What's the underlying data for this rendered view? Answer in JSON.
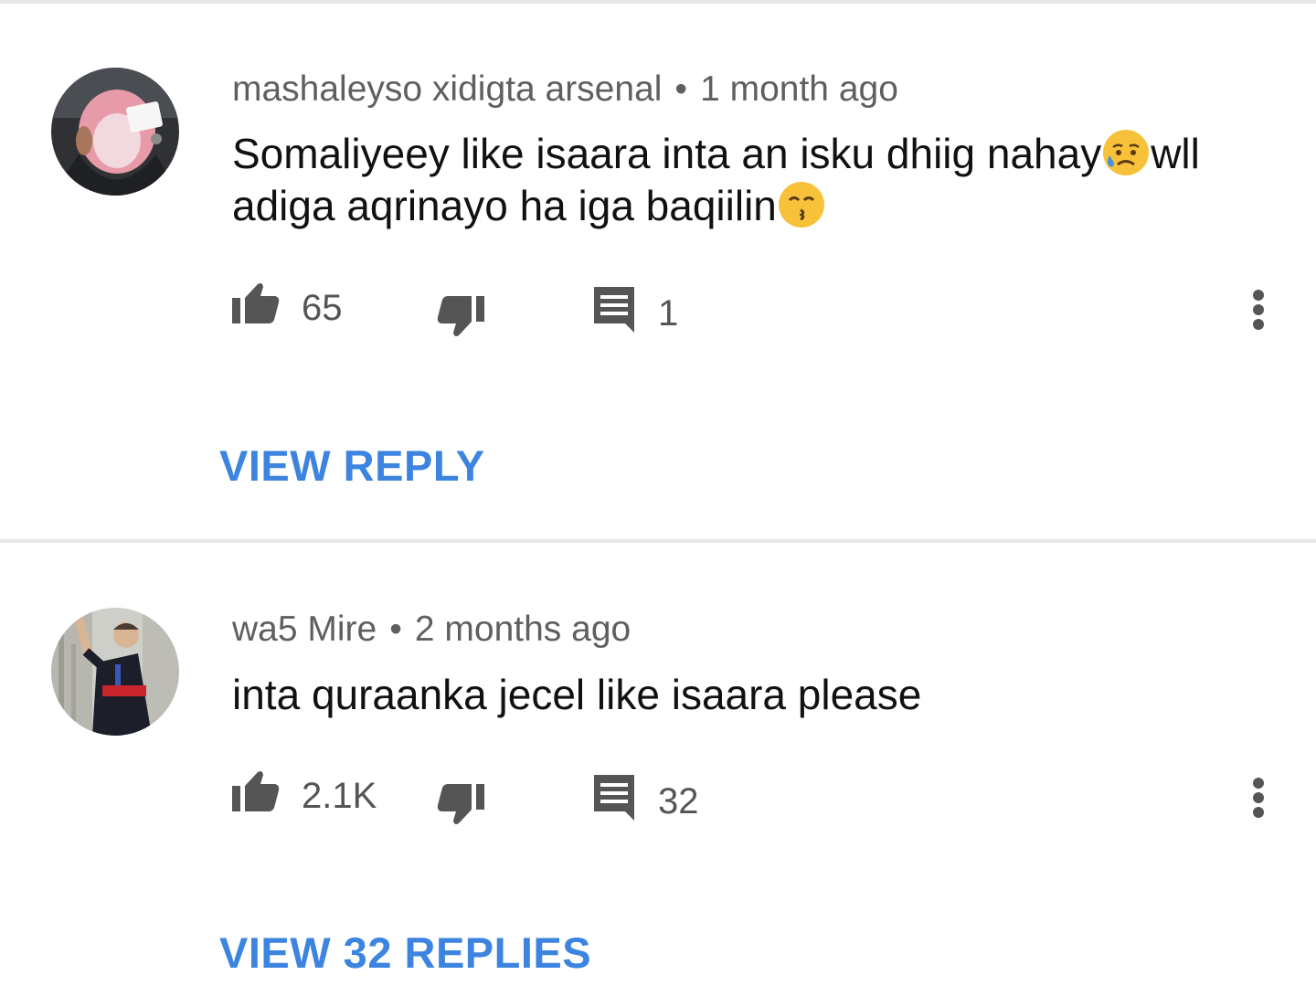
{
  "comments": [
    {
      "author": "mashaleyso xidigta arsenal",
      "separator": "•",
      "time": "1 month ago",
      "text_line1": "Somaliyeey like isaara inta an isku dhiig nahay",
      "text_line1_end": "wll",
      "text_line2": "adiga aqrinayo ha iga baqiilin",
      "emoji_1": "sad-but-relieved-face-emoji",
      "emoji_2": "kissing-face-emoji",
      "likes": "65",
      "replies_count": "1",
      "reply_link": "VIEW REPLY"
    },
    {
      "author": "wa5 Mire",
      "separator": "•",
      "time": "2 months ago",
      "text": "inta quraanka jecel like isaara please",
      "likes": "2.1K",
      "replies_count": "32",
      "reply_link": "VIEW 32 REPLIES"
    }
  ],
  "colors": {
    "link": "#3c84e0",
    "meta_text": "#5f5f5f",
    "body_text": "#111111",
    "icon": "#555555",
    "divider": "#e6e6e6"
  },
  "icons": {
    "like": "thumbs-up-icon",
    "dislike": "thumbs-down-icon",
    "reply": "comment-icon",
    "more": "more-vert-icon"
  }
}
